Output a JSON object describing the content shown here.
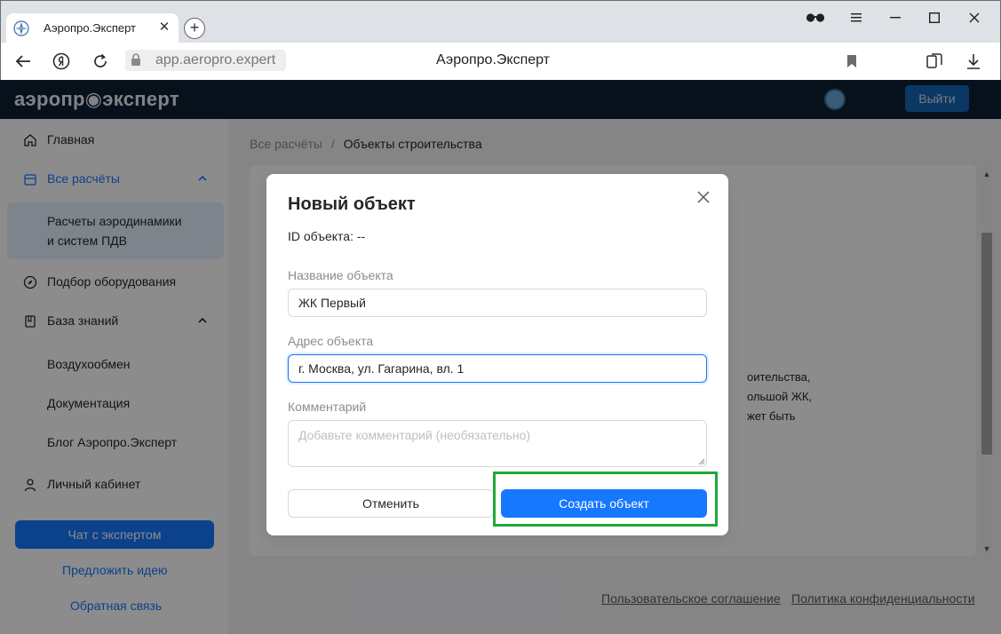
{
  "browser": {
    "tab_title": "Аэропро.Эксперт",
    "new_tab_symbol": "+",
    "url": "app.aeropro.expert",
    "page_title": "Аэропро.Эксперт",
    "icons": [
      "tab-favicon-icon",
      "tab-close-icon",
      "new-tab-icon",
      "reader-mode-icon",
      "menu-icon",
      "minimize-icon",
      "maximize-icon",
      "close-window-icon",
      "back-icon",
      "yandex-icon",
      "reload-icon",
      "lock-icon",
      "bookmark-icon",
      "collections-icon",
      "download-icon"
    ]
  },
  "header": {
    "logo": "аэропр◉эксперт",
    "logout_label": "Выйти"
  },
  "sidebar": {
    "home": "Главная",
    "all_calcs": "Все расчёты",
    "calc_aero_line1": "Расчеты аэродинамики",
    "calc_aero_line2": "и систем ПДВ",
    "equipment": "Подбор оборудования",
    "knowledge": "База знаний",
    "air_exchange": "Воздухообмен",
    "docs": "Документация",
    "blog": "Блог Аэропро.Эксперт",
    "cabinet": "Личный кабинет",
    "chat_button": "Чат с экспертом",
    "suggest_idea": "Предложить идею",
    "feedback": "Обратная связь"
  },
  "main": {
    "breadcrumb_root": "Все расчёты",
    "breadcrumb_sep": "/",
    "breadcrumb_current": "Объекты строительства",
    "background_text": "оительства,\nольшой ЖК,\nжет быть",
    "footer_agreement": "Пользовательское соглашение",
    "footer_privacy": "Политика конфиденциальности"
  },
  "modal": {
    "title": "Новый объект",
    "object_id": "ID объекта: --",
    "name_label": "Название объекта",
    "name_value": "ЖК Первый",
    "address_label": "Адрес объекта",
    "address_value": "г. Москва, ул. Гагарина, вл. 1",
    "comment_label": "Комментарий",
    "comment_placeholder": "Добавьте комментарий (необязательно)",
    "cancel_label": "Отменить",
    "create_label": "Создать объект"
  },
  "colors": {
    "accent": "#1677ff",
    "header_bg": "#0c1f33",
    "highlight": "#22a73b"
  }
}
